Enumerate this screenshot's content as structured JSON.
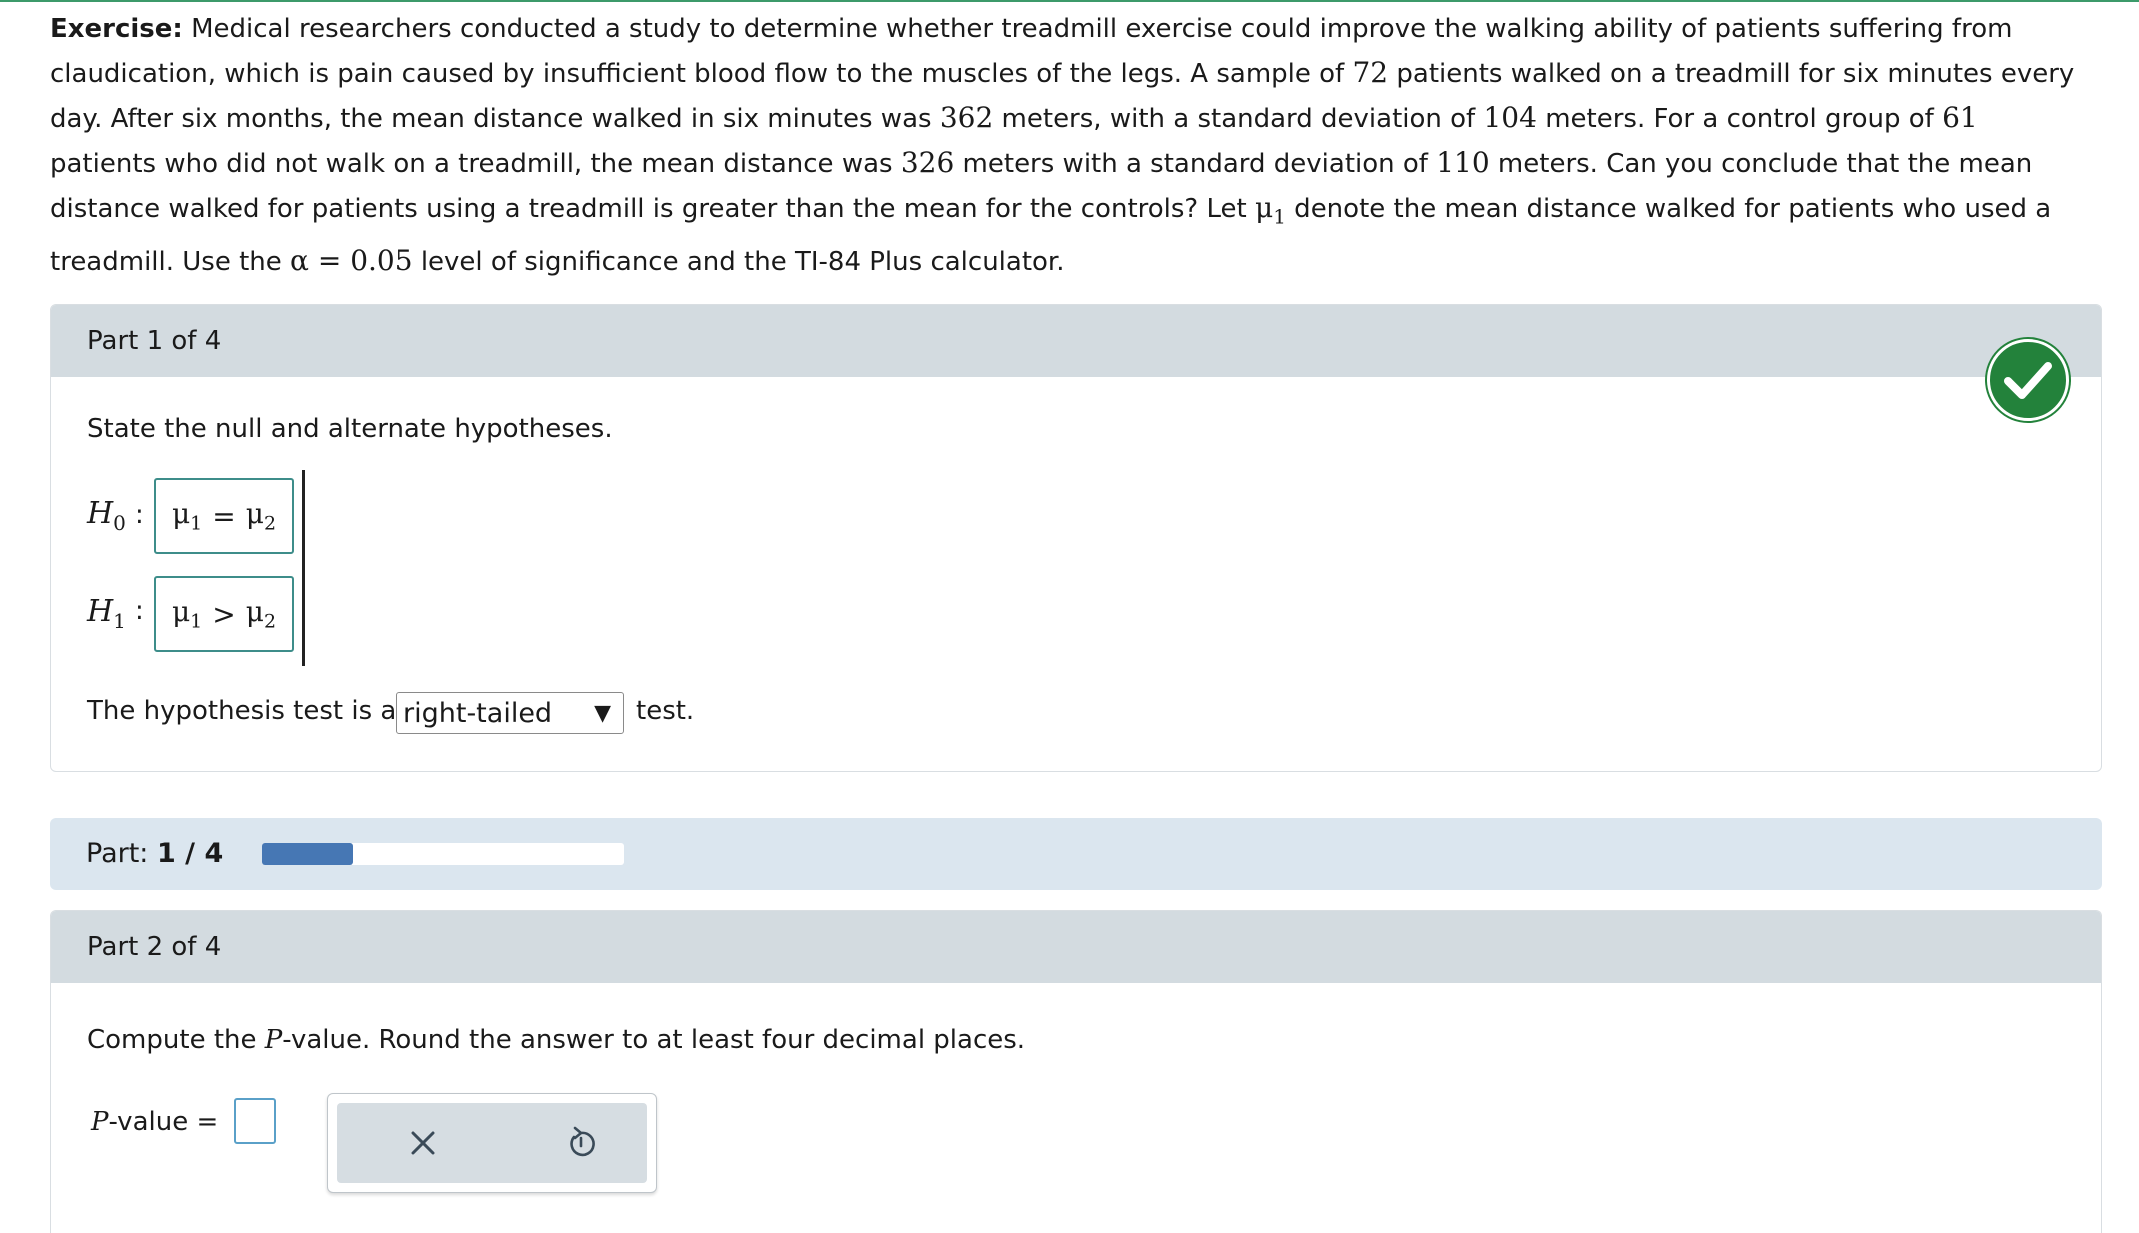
{
  "exercise": {
    "label": "Exercise:",
    "seg1": " Medical researchers conducted a study to determine whether treadmill exercise could improve the walking ability of patients suffering from claudication, which is pain caused by insufficient blood flow to the muscles of the legs. A sample of ",
    "n1": "72",
    "seg2": " patients walked on a treadmill for six minutes every day. After six months, the mean distance walked in six minutes was ",
    "mean1": "362",
    "seg3": " meters, with a standard deviation of ",
    "sd1": "104",
    "seg4": " meters. For a control group of ",
    "n2": "61",
    "seg5": " patients who did not walk on a treadmill, the mean distance was ",
    "mean2": "326",
    "seg6": " meters with a standard deviation of ",
    "sd2": "110",
    "seg7": " meters. Can you conclude that the mean distance walked for patients using a treadmill is greater than the mean for the controls? Let ",
    "mu_symbol": "μ",
    "mu_sub": "1",
    "seg8": " denote the mean distance walked for patients who used a treadmill. Use the ",
    "alpha": "α = 0.05",
    "seg9": " level of significance and the TI-84 Plus calculator."
  },
  "part1": {
    "title": "Part 1 of 4",
    "prompt": "State the null and alternate hypotheses.",
    "h0": {
      "letter": "H",
      "sub": "0",
      "colon": ":",
      "left": "μ",
      "left_sub": "1",
      "op": "=",
      "right": "μ",
      "right_sub": "2"
    },
    "h1": {
      "letter": "H",
      "sub": "1",
      "colon": ":",
      "left": "μ",
      "left_sub": "1",
      "op": ">",
      "right": "μ",
      "right_sub": "2"
    },
    "test_prefix": "The hypothesis test is a",
    "test_value": "right-tailed",
    "test_arrow": "▼",
    "test_suffix": "test.",
    "status_icon": "check-circle-icon"
  },
  "progress": {
    "label": "Part:",
    "current": "1 / 4",
    "fraction": 0.25,
    "fill_color": "#4677b4"
  },
  "part2": {
    "title": "Part 2 of 4",
    "prompt_a": "Compute the ",
    "prompt_p": "P",
    "prompt_b": "-value. Round the answer to at least four decimal places.",
    "answer_label_p": "P",
    "answer_label_rest": "-value =",
    "answer_value": "",
    "tools": [
      "clear-x-icon",
      "undo-icon"
    ]
  }
}
